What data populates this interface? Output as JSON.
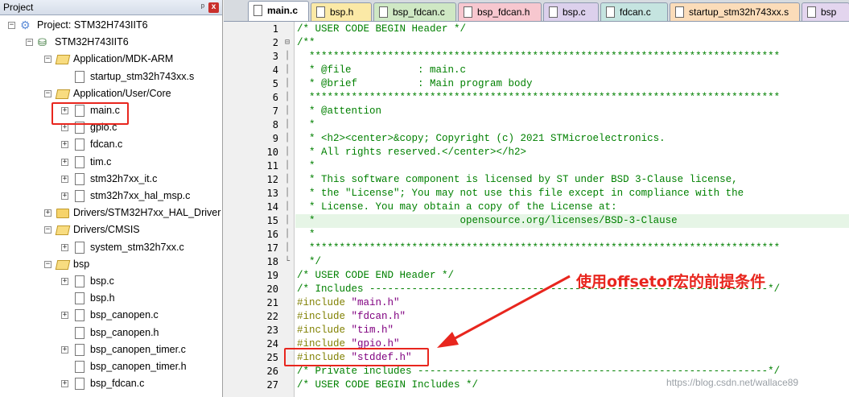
{
  "project_panel": {
    "title": "Project",
    "pin_glyph": "ᵖ",
    "close_glyph": "x",
    "tree": [
      {
        "label": "Project: STM32H743IIT6",
        "icon": "project-icon",
        "expander": "−",
        "depth": 0
      },
      {
        "label": "STM32H743IIT6",
        "icon": "target-icon",
        "expander": "−",
        "depth": 1
      },
      {
        "label": "Application/MDK-ARM",
        "icon": "folder-open-icon",
        "expander": "−",
        "depth": 2
      },
      {
        "label": "startup_stm32h743xx.s",
        "icon": "file-icon",
        "expander": "",
        "depth": 3
      },
      {
        "label": "Application/User/Core",
        "icon": "folder-open-icon",
        "expander": "−",
        "depth": 2
      },
      {
        "label": "main.c",
        "icon": "file-icon",
        "expander": "+",
        "depth": 3
      },
      {
        "label": "gpio.c",
        "icon": "file-icon",
        "expander": "+",
        "depth": 3
      },
      {
        "label": "fdcan.c",
        "icon": "file-icon",
        "expander": "+",
        "depth": 3
      },
      {
        "label": "tim.c",
        "icon": "file-gear-icon",
        "expander": "+",
        "depth": 3
      },
      {
        "label": "stm32h7xx_it.c",
        "icon": "file-icon",
        "expander": "+",
        "depth": 3
      },
      {
        "label": "stm32h7xx_hal_msp.c",
        "icon": "file-icon",
        "expander": "+",
        "depth": 3
      },
      {
        "label": "Drivers/STM32H7xx_HAL_Driver",
        "icon": "folder-icon",
        "expander": "+",
        "depth": 2
      },
      {
        "label": "Drivers/CMSIS",
        "icon": "folder-open-icon",
        "expander": "−",
        "depth": 2
      },
      {
        "label": "system_stm32h7xx.c",
        "icon": "file-icon",
        "expander": "+",
        "depth": 3
      },
      {
        "label": "bsp",
        "icon": "folder-open-icon",
        "expander": "−",
        "depth": 2
      },
      {
        "label": "bsp.c",
        "icon": "file-icon",
        "expander": "+",
        "depth": 3
      },
      {
        "label": "bsp.h",
        "icon": "file-icon",
        "expander": "",
        "depth": 3
      },
      {
        "label": "bsp_canopen.c",
        "icon": "file-icon",
        "expander": "+",
        "depth": 3
      },
      {
        "label": "bsp_canopen.h",
        "icon": "file-icon",
        "expander": "",
        "depth": 3
      },
      {
        "label": "bsp_canopen_timer.c",
        "icon": "file-icon",
        "expander": "+",
        "depth": 3
      },
      {
        "label": "bsp_canopen_timer.h",
        "icon": "file-icon",
        "expander": "",
        "depth": 3
      },
      {
        "label": "bsp_fdcan.c",
        "icon": "file-icon",
        "expander": "+",
        "depth": 3
      }
    ]
  },
  "tabs": [
    {
      "label": "main.c",
      "color": "#ffffff",
      "active": true
    },
    {
      "label": "bsp.h",
      "color": "#fbe9a6",
      "active": false
    },
    {
      "label": "bsp_fdcan.c",
      "color": "#cfe8c4",
      "active": false
    },
    {
      "label": "bsp_fdcan.h",
      "color": "#f7c7cf",
      "active": false
    },
    {
      "label": "bsp.c",
      "color": "#dcd0ec",
      "active": false
    },
    {
      "label": "fdcan.c",
      "color": "#c5e4e0",
      "active": false
    },
    {
      "label": "startup_stm32h743xx.s",
      "color": "#fbdcb9",
      "active": false
    },
    {
      "label": "bsp",
      "color": "#e3d5ee",
      "active": false
    }
  ],
  "code": [
    {
      "n": "1",
      "fold": "",
      "parts": [
        {
          "t": "/* USER CODE BEGIN Header */",
          "k": "comment"
        }
      ]
    },
    {
      "n": "2",
      "fold": "⊟",
      "parts": [
        {
          "t": "/**",
          "k": "comment"
        }
      ]
    },
    {
      "n": "3",
      "fold": "│",
      "parts": [
        {
          "t": "  ******************************************************************************",
          "k": "comment"
        }
      ]
    },
    {
      "n": "4",
      "fold": "│",
      "parts": [
        {
          "t": "  * @file           : main.c",
          "k": "comment"
        }
      ]
    },
    {
      "n": "5",
      "fold": "│",
      "parts": [
        {
          "t": "  * @brief          : Main program body",
          "k": "comment"
        }
      ]
    },
    {
      "n": "6",
      "fold": "│",
      "parts": [
        {
          "t": "  ******************************************************************************",
          "k": "comment"
        }
      ]
    },
    {
      "n": "7",
      "fold": "│",
      "parts": [
        {
          "t": "  * @attention",
          "k": "comment"
        }
      ]
    },
    {
      "n": "8",
      "fold": "│",
      "parts": [
        {
          "t": "  *",
          "k": "comment"
        }
      ]
    },
    {
      "n": "9",
      "fold": "│",
      "parts": [
        {
          "t": "  * <h2><center>&copy; Copyright (c) 2021 STMicroelectronics.",
          "k": "comment"
        }
      ]
    },
    {
      "n": "10",
      "fold": "│",
      "parts": [
        {
          "t": "  * All rights reserved.</center></h2>",
          "k": "comment"
        }
      ]
    },
    {
      "n": "11",
      "fold": "│",
      "parts": [
        {
          "t": "  *",
          "k": "comment"
        }
      ]
    },
    {
      "n": "12",
      "fold": "│",
      "parts": [
        {
          "t": "  * This software component is licensed by ST under BSD 3-Clause license,",
          "k": "comment"
        }
      ]
    },
    {
      "n": "13",
      "fold": "│",
      "parts": [
        {
          "t": "  * the \"License\"; You may not use this file except in compliance with the",
          "k": "comment"
        }
      ]
    },
    {
      "n": "14",
      "fold": "│",
      "parts": [
        {
          "t": "  * License. You may obtain a copy of the License at:",
          "k": "comment"
        }
      ]
    },
    {
      "n": "15",
      "fold": "│",
      "highlight": true,
      "parts": [
        {
          "t": "  *                        opensource.org/licenses/BSD-3-Clause",
          "k": "comment"
        }
      ]
    },
    {
      "n": "16",
      "fold": "│",
      "parts": [
        {
          "t": "  *",
          "k": "comment"
        }
      ]
    },
    {
      "n": "17",
      "fold": "│",
      "parts": [
        {
          "t": "  ******************************************************************************",
          "k": "comment"
        }
      ]
    },
    {
      "n": "18",
      "fold": "└",
      "parts": [
        {
          "t": "  */",
          "k": "comment"
        }
      ]
    },
    {
      "n": "19",
      "fold": "",
      "parts": [
        {
          "t": "/* USER CODE END Header */",
          "k": "comment"
        }
      ]
    },
    {
      "n": "20",
      "fold": "",
      "parts": [
        {
          "t": "/* Includes ------------------------------------------------------------------*/",
          "k": "comment"
        }
      ]
    },
    {
      "n": "21",
      "fold": "",
      "parts": [
        {
          "t": "#include ",
          "k": "directive"
        },
        {
          "t": "\"main.h\"",
          "k": "string"
        }
      ]
    },
    {
      "n": "22",
      "fold": "",
      "parts": [
        {
          "t": "#include ",
          "k": "directive"
        },
        {
          "t": "\"fdcan.h\"",
          "k": "string"
        }
      ]
    },
    {
      "n": "23",
      "fold": "",
      "parts": [
        {
          "t": "#include ",
          "k": "directive"
        },
        {
          "t": "\"tim.h\"",
          "k": "string"
        }
      ]
    },
    {
      "n": "24",
      "fold": "",
      "parts": [
        {
          "t": "#include ",
          "k": "directive"
        },
        {
          "t": "\"gpio.h\"",
          "k": "string"
        }
      ]
    },
    {
      "n": "25",
      "fold": "",
      "parts": [
        {
          "t": "#include ",
          "k": "directive"
        },
        {
          "t": "\"stddef.h\"",
          "k": "string"
        }
      ]
    },
    {
      "n": "26",
      "fold": "",
      "parts": [
        {
          "t": "/* Private includes ----------------------------------------------------------*/",
          "k": "comment"
        }
      ]
    },
    {
      "n": "27",
      "fold": "",
      "parts": [
        {
          "t": "/* USER CODE BEGIN Includes */",
          "k": "comment"
        }
      ]
    }
  ],
  "annotation": {
    "text": "使用offsetof宏的前提条件",
    "color": "#e8261e"
  },
  "watermark": "https://blog.csdn.net/wallace89"
}
